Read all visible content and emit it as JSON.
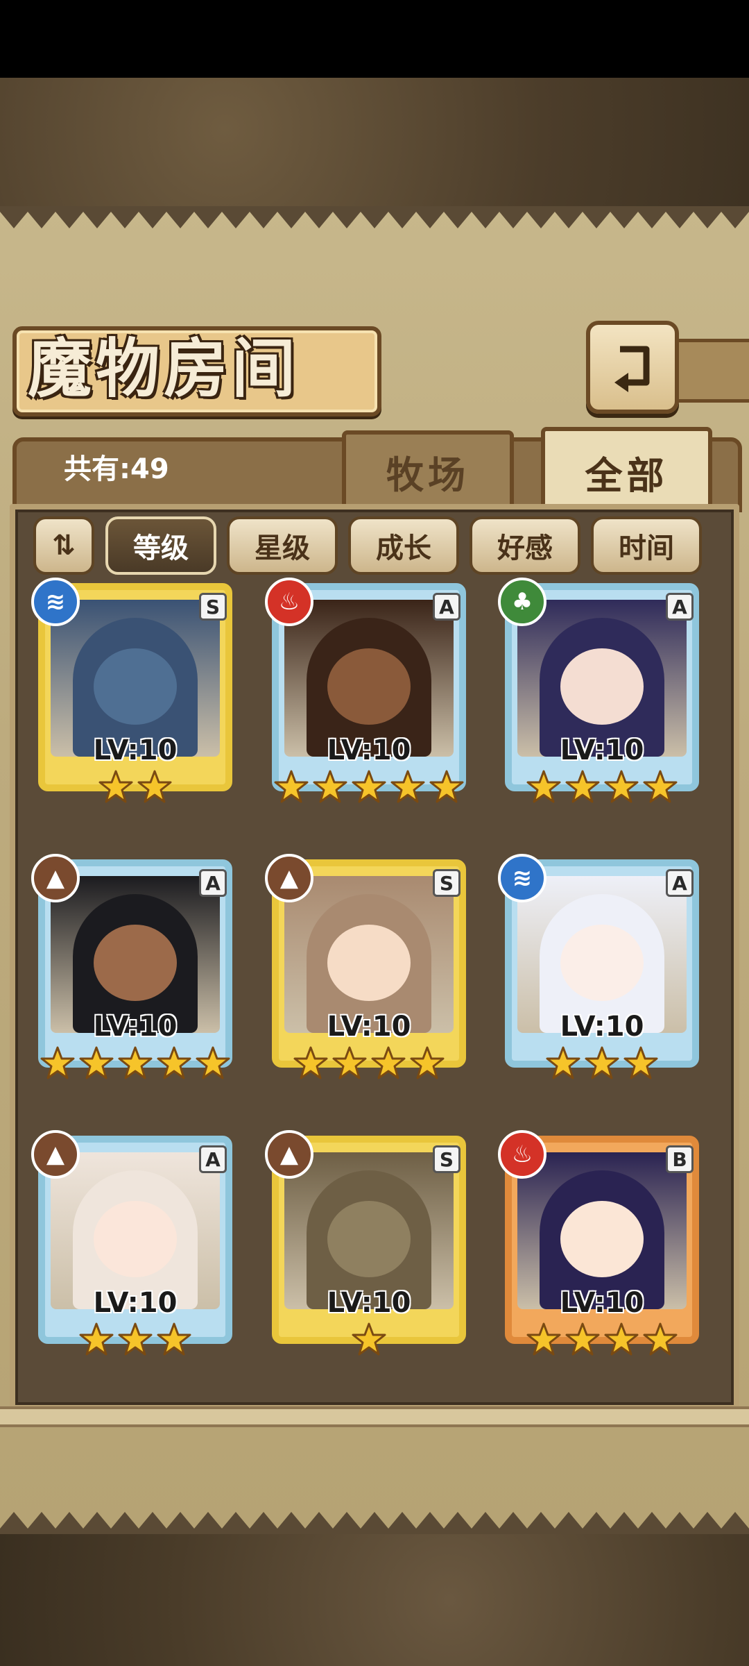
{
  "title": "魔物房间",
  "count_label": "共有:49",
  "tabs": [
    {
      "label": "牧场",
      "active": false
    },
    {
      "label": "全部",
      "active": true
    }
  ],
  "sort_toggle_label": "⇅",
  "filters": [
    {
      "label": "等级",
      "active": true
    },
    {
      "label": "星级",
      "active": false
    },
    {
      "label": "成长",
      "active": false
    },
    {
      "label": "好感",
      "active": false
    },
    {
      "label": "时间",
      "active": false
    }
  ],
  "monsters": [
    {
      "level": "LV:10",
      "rank": "S",
      "element": "water",
      "stars": 2,
      "skin": "#4f6f93",
      "hair": "#3a5274"
    },
    {
      "level": "LV:10",
      "rank": "A",
      "element": "fire",
      "stars": 5,
      "skin": "#8a5a3a",
      "hair": "#3a2418"
    },
    {
      "level": "LV:10",
      "rank": "A",
      "element": "wood",
      "stars": 4,
      "skin": "#f4ddd2",
      "hair": "#2f2b5a"
    },
    {
      "level": "LV:10",
      "rank": "A",
      "element": "earth",
      "stars": 5,
      "skin": "#9c6a4a",
      "hair": "#1b1b1f"
    },
    {
      "level": "LV:10",
      "rank": "S",
      "element": "earth",
      "stars": 4,
      "skin": "#f6dcc6",
      "hair": "#a98a70"
    },
    {
      "level": "LV:10",
      "rank": "A",
      "element": "water",
      "stars": 3,
      "skin": "#fbeee8",
      "hair": "#eef0f8"
    },
    {
      "level": "LV:10",
      "rank": "A",
      "element": "earth",
      "stars": 3,
      "skin": "#fbe6da",
      "hair": "#efe5dc"
    },
    {
      "level": "LV:10",
      "rank": "S",
      "element": "earth",
      "stars": 1,
      "skin": "#8f8060",
      "hair": "#6e5f45"
    },
    {
      "level": "LV:10",
      "rank": "B",
      "element": "fire",
      "stars": 4,
      "skin": "#fbe6d6",
      "hair": "#2a2352"
    }
  ],
  "colors": {
    "frame_S": "#e9c63b",
    "frame_A": "#8fc6dc",
    "frame_B": "#e08a3b",
    "star": "#f6c42a"
  }
}
